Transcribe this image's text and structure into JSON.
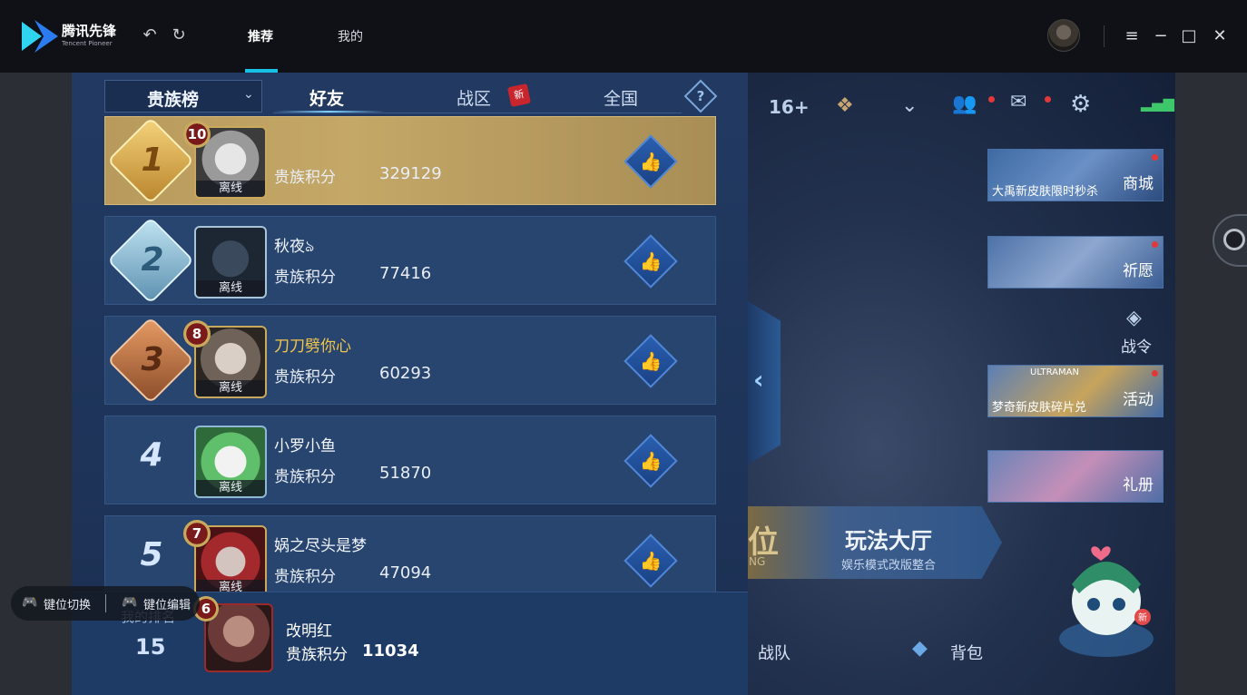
{
  "app": {
    "logo_text": "腾讯先锋",
    "logo_subtext": "Tencent Pioneer",
    "nav_tabs": [
      {
        "label": "推荐",
        "active": true
      },
      {
        "label": "我的",
        "active": false
      }
    ],
    "accent_color": "#17c1e6"
  },
  "leaderboard": {
    "selector_label": "贵族榜",
    "tabs": [
      {
        "label": "好友",
        "active": true
      },
      {
        "label": "战区",
        "active": false,
        "badge": "新"
      },
      {
        "label": "全国",
        "active": false
      }
    ],
    "help_symbol": "?",
    "offline_label": "离线",
    "score_label": "贵族积分",
    "rows": [
      {
        "rank": "1",
        "level": "10",
        "name": "",
        "score": "329129"
      },
      {
        "rank": "2",
        "level": "",
        "name": "秋夜ঌ",
        "score": "77416"
      },
      {
        "rank": "3",
        "level": "8",
        "name": "刀刀劈你心",
        "score": "60293"
      },
      {
        "rank": "4",
        "level": "",
        "name": "小罗小鱼",
        "score": "51870"
      },
      {
        "rank": "5",
        "level": "7",
        "name": "娲之尽头是梦",
        "score": "47094"
      }
    ],
    "my_rank": {
      "label": "我的排名",
      "rank": "15",
      "level": "6",
      "name": "改明红",
      "score_label": "贵族积分",
      "score": "11034"
    }
  },
  "key_controls": {
    "switch_label": "键位切换",
    "edit_label": "键位编辑"
  },
  "game_hud": {
    "age_rating": "16+",
    "shop_caption": "大禹新皮肤限时秒杀",
    "shop_tag": "商城",
    "wish_tag": "祈愿",
    "battle_pass_label": "战令",
    "event_header": "ULTRAMAN",
    "event_caption": "梦奇新皮肤碎片兑",
    "event_tag": "活动",
    "gift_tag": "礼册",
    "mode_left_text": "位",
    "mode_left_sub": "NG",
    "mode_title": "玩法大厅",
    "mode_subtitle": "娱乐模式改版整合",
    "bottom_team": "战队",
    "bottom_bag": "背包",
    "mascot_badge": "新"
  }
}
